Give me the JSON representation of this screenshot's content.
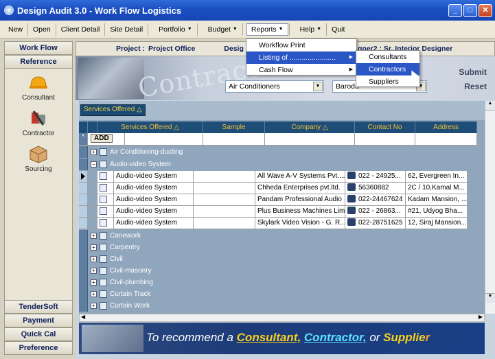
{
  "window": {
    "title": "Design Audit 3.0 - Work Flow Logistics"
  },
  "menubar": {
    "items": [
      {
        "label": "New"
      },
      {
        "label": "Open"
      },
      {
        "label": "Client Detail"
      },
      {
        "label": "Site Detail"
      },
      {
        "label": "Portfolio",
        "dropdown": true
      },
      {
        "label": "Budget",
        "dropdown": true
      },
      {
        "label": "Reports",
        "dropdown": true
      },
      {
        "label": "Help",
        "dropdown": true
      },
      {
        "label": "Quit"
      }
    ]
  },
  "reports_menu": {
    "items": [
      {
        "label": "Workflow Print"
      },
      {
        "label": "Listing of ......................."
      },
      {
        "label": "Cash Flow"
      }
    ]
  },
  "listing_submenu": {
    "items": [
      {
        "label": "Consultants"
      },
      {
        "label": "Contractors"
      },
      {
        "label": "Suppliers"
      }
    ]
  },
  "left": {
    "top_tabs": [
      "Work Flow",
      "Reference"
    ],
    "items": [
      {
        "label": "Consultant",
        "icon": "hardhat-icon"
      },
      {
        "label": "Contractor",
        "icon": "tools-icon"
      },
      {
        "label": "Sourcing",
        "icon": "box-icon"
      }
    ],
    "bottom_tabs": [
      "TenderSoft",
      "Payment",
      "Quick Cal",
      "Preference"
    ]
  },
  "project": {
    "label": "Project :",
    "name": "Project Office",
    "designer_label": "Desig",
    "designer_right": "gner2 :  Sr. Interior Designer"
  },
  "banner": {
    "watermark": "Contractor",
    "category": "Air Conditioners",
    "city": "Baroda",
    "submit": "Submit",
    "reset": "Reset"
  },
  "grid": {
    "group_tag": "Services Offered △",
    "columns": [
      "Services Offered △",
      "Sample",
      "Company △",
      "Contact No",
      "Address"
    ],
    "add_label": "ADD",
    "groups_before": [
      {
        "name": "Air Conditioning-ducting",
        "sign": "+"
      },
      {
        "name": "Audio-video System",
        "sign": "−"
      }
    ],
    "rows": [
      {
        "service": "Audio-video System",
        "company": "All Wave A-V Systems Pvt....",
        "contact": "022 - 24925...",
        "address": "62, Evergreen In..."
      },
      {
        "service": "Audio-video System",
        "company": "Chheda Enterprises pvt.ltd.",
        "contact": "56360882",
        "address": "2C / 10,Kamal M..."
      },
      {
        "service": "Audio-video System",
        "company": "Pandam Professional Audio",
        "contact": "022-24467624",
        "address": "Kadam Mansion, ..."
      },
      {
        "service": "Audio-video System",
        "company": "Plus Business Machines Limi...",
        "contact": "022 - 26863...",
        "address": "#21, Udyog Bha..."
      },
      {
        "service": "Audio-video System",
        "company": "Skylark Video Vision - G. R....",
        "contact": "022-28751625",
        "address": "12, Siraj Mansion..."
      }
    ],
    "groups_after": [
      "Canework",
      "Carpentry",
      "Civil",
      "Civil-masonry",
      "Civil-plumbing",
      "Curtain Track",
      "Curtain Work"
    ]
  },
  "footer": {
    "pre": "To recommend a",
    "w1": "Consultant,",
    "w2": "Contractor,",
    "mid": "or",
    "w3": "Supplie",
    "w3b": "r"
  },
  "colors": {
    "title_blue": "#1b4fc2",
    "header_navy": "#1e4d78",
    "header_text": "#f0c030",
    "highlight": "#2a56c6"
  }
}
